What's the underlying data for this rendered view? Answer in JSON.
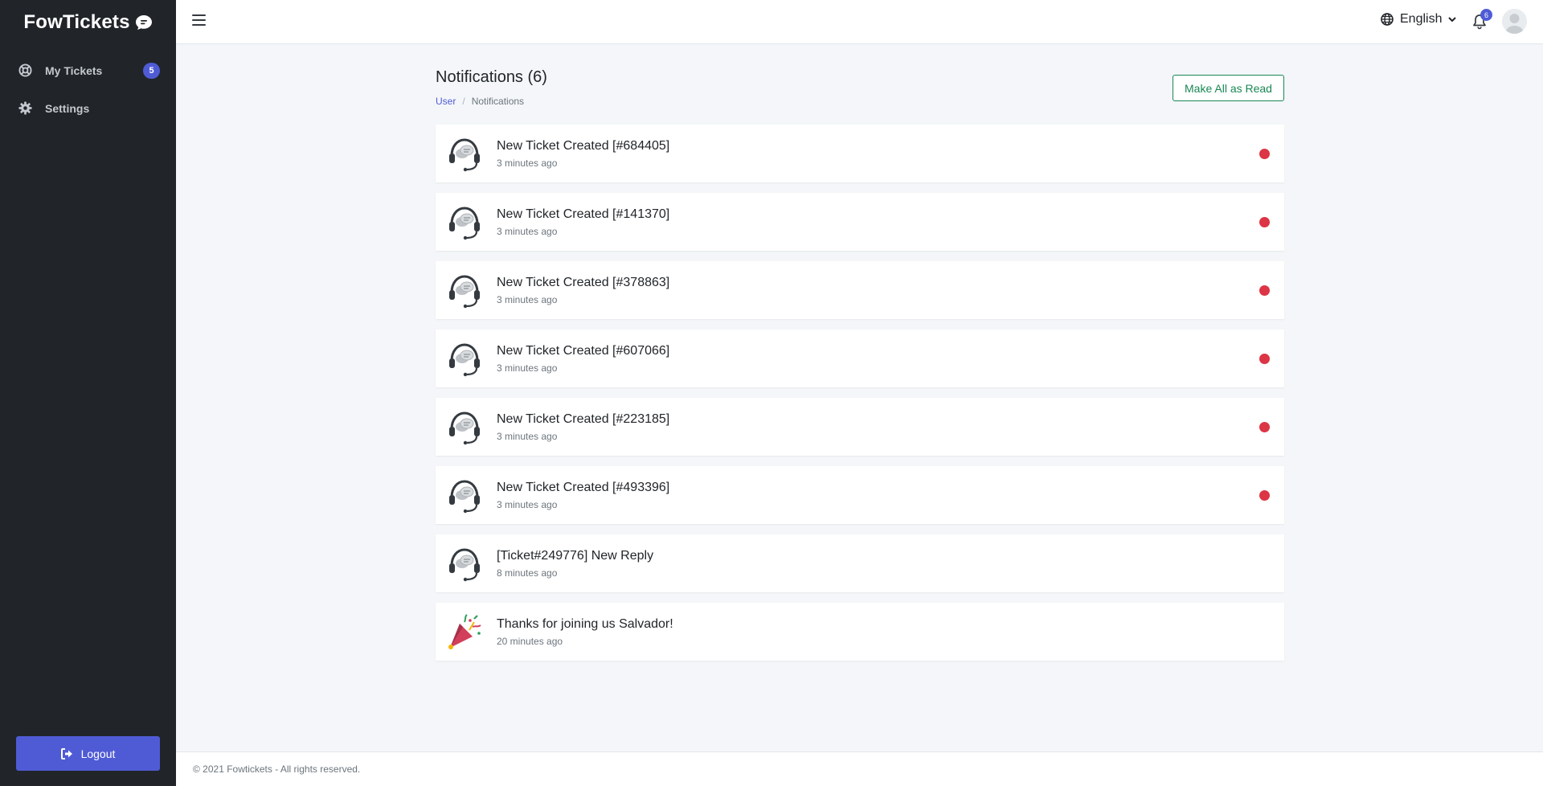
{
  "brand": {
    "name": "FowTickets"
  },
  "sidebar": {
    "items": [
      {
        "label": "My Tickets",
        "icon": "life-ring-icon",
        "badge": "5"
      },
      {
        "label": "Settings",
        "icon": "gear-icon"
      }
    ],
    "logout_label": "Logout"
  },
  "topbar": {
    "language": "English",
    "notification_count": "6"
  },
  "page": {
    "title": "Notifications (6)",
    "breadcrumb": [
      "User",
      "Notifications"
    ],
    "mark_all_label": "Make All as Read"
  },
  "notifications": [
    {
      "title": "New Ticket Created [#684405]",
      "time": "3 minutes ago",
      "icon": "support-headset-icon",
      "unread": true
    },
    {
      "title": "New Ticket Created [#141370]",
      "time": "3 minutes ago",
      "icon": "support-headset-icon",
      "unread": true
    },
    {
      "title": "New Ticket Created [#378863]",
      "time": "3 minutes ago",
      "icon": "support-headset-icon",
      "unread": true
    },
    {
      "title": "New Ticket Created [#607066]",
      "time": "3 minutes ago",
      "icon": "support-headset-icon",
      "unread": true
    },
    {
      "title": "New Ticket Created [#223185]",
      "time": "3 minutes ago",
      "icon": "support-headset-icon",
      "unread": true
    },
    {
      "title": "New Ticket Created [#493396]",
      "time": "3 minutes ago",
      "icon": "support-headset-icon",
      "unread": true
    },
    {
      "title": "[Ticket#249776] New Reply",
      "time": "8 minutes ago",
      "icon": "support-headset-icon",
      "unread": false
    },
    {
      "title": "Thanks for joining us Salvador!",
      "time": "20 minutes ago",
      "icon": "party-popper-icon",
      "unread": false
    }
  ],
  "footer": {
    "text": "© 2021 Fowtickets - All rights reserved."
  },
  "colors": {
    "sidebar_bg": "#212529",
    "accent": "#4f5bd5",
    "success": "#198754",
    "unread": "#dc3545",
    "page_bg": "#f4f6f9"
  }
}
